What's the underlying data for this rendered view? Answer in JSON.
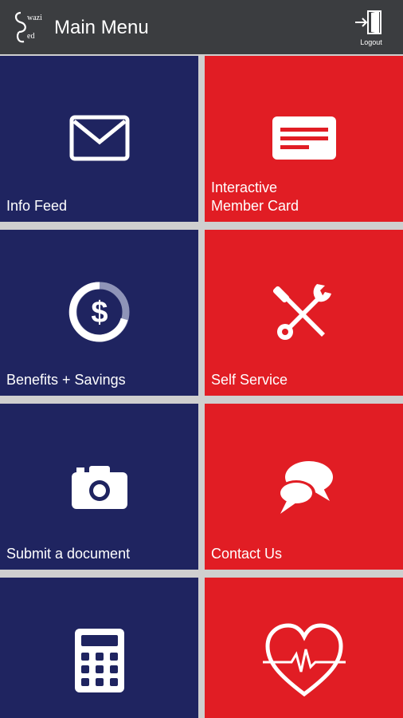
{
  "header": {
    "title": "Main Menu",
    "logout_label": "Logout",
    "logo_text": "SwaziMed"
  },
  "colors": {
    "navy": "#1f2460",
    "red": "#e11d24",
    "topbar": "#3b3d40"
  },
  "tiles": [
    {
      "label": "Info Feed",
      "icon": "envelope-icon"
    },
    {
      "label": "Interactive\nMember Card",
      "icon": "member-card-icon"
    },
    {
      "label": "Benefits + Savings",
      "icon": "dollar-gauge-icon"
    },
    {
      "label": "Self Service",
      "icon": "tools-icon"
    },
    {
      "label": "Submit a document",
      "icon": "camera-icon"
    },
    {
      "label": "Contact Us",
      "icon": "chat-bubbles-icon"
    },
    {
      "label": "",
      "icon": "calculator-icon"
    },
    {
      "label": "",
      "icon": "heartbeat-icon"
    }
  ]
}
